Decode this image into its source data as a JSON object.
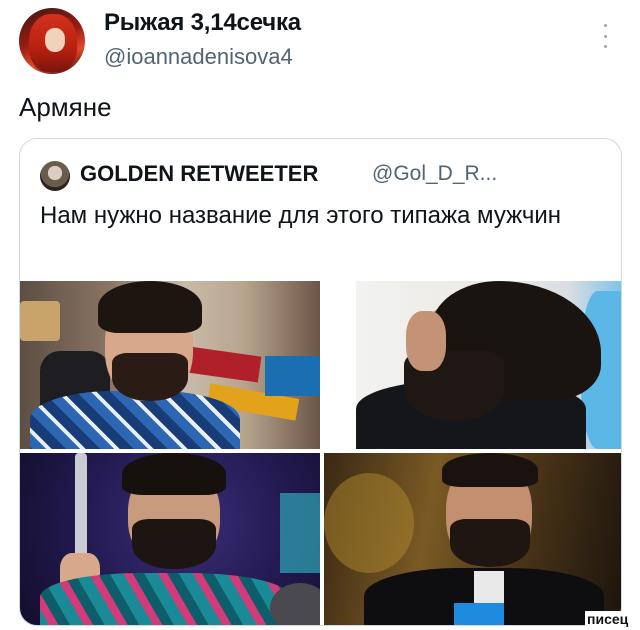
{
  "tweet": {
    "display_name": "Рыжая 3,14сечка",
    "handle": "@ioannadenisova4",
    "text": "Армяне",
    "avatar_icon": "profile-avatar-redhead-illustration"
  },
  "quoted_tweet": {
    "display_name": "GOLDEN RETWEETER",
    "handle": "@Gol_D_R...",
    "text": "Нам нужно название для этого типажа мужчин",
    "avatar_icon": "profile-avatar-dog"
  },
  "photos": [
    {
      "subject": "bearded man in hawaiian shirt, youtube studio background"
    },
    {
      "subject": "bearded man with long dark hair in profile"
    },
    {
      "subject": "bearded man holding a prop gun, purple lighting"
    },
    {
      "subject": "bearded man in dark suit, warm blurred background"
    }
  ],
  "watermark": "писец",
  "colors": {
    "text_primary": "#0f1419",
    "text_secondary": "#536471",
    "card_border": "#cfd9de",
    "background": "#ffffff"
  }
}
